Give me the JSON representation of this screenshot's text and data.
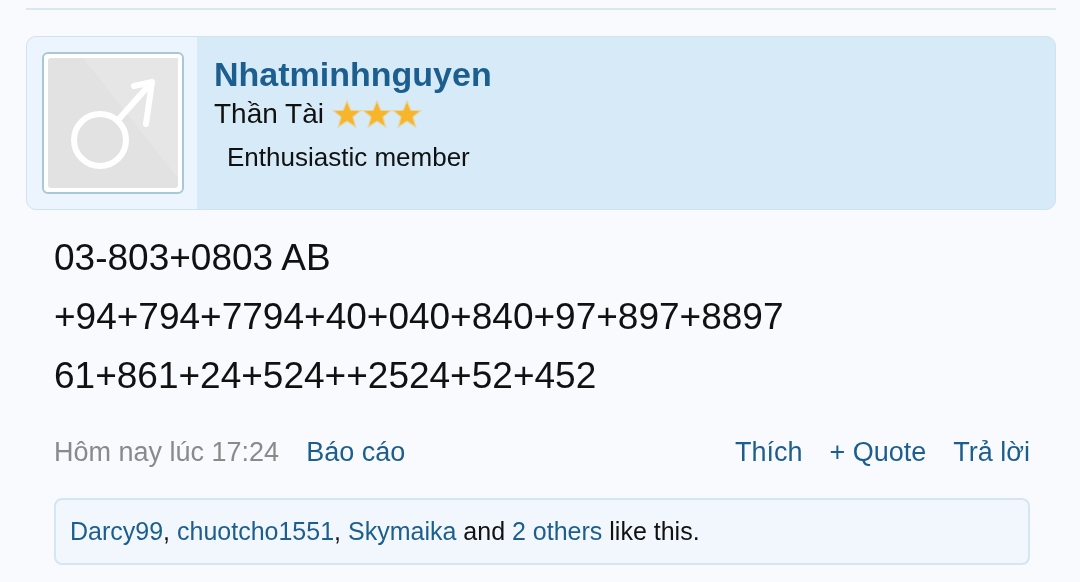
{
  "author": {
    "name": "Nhatminhnguyen",
    "rank": "Thần Tài",
    "stars": 3,
    "title": "Enthusiastic member"
  },
  "message_lines": [
    "03-803+0803 AB",
    "+94+794+7794+40+040+840+97+897+8897",
    "61+861+24+524++2524+52+452"
  ],
  "footer": {
    "time": "Hôm nay lúc 17:24",
    "report": "Báo cáo",
    "actions": [
      "Thích",
      "+ Quote",
      "Trả lời"
    ]
  },
  "likes": [
    {
      "kind": "link",
      "text": "Darcy99"
    },
    {
      "kind": "text",
      "text": ", "
    },
    {
      "kind": "link",
      "text": "chuotcho1551"
    },
    {
      "kind": "text",
      "text": ", "
    },
    {
      "kind": "link",
      "text": "Skymaika"
    },
    {
      "kind": "text",
      "text": " and "
    },
    {
      "kind": "link",
      "text": "2 others"
    },
    {
      "kind": "text",
      "text": " like this."
    }
  ]
}
